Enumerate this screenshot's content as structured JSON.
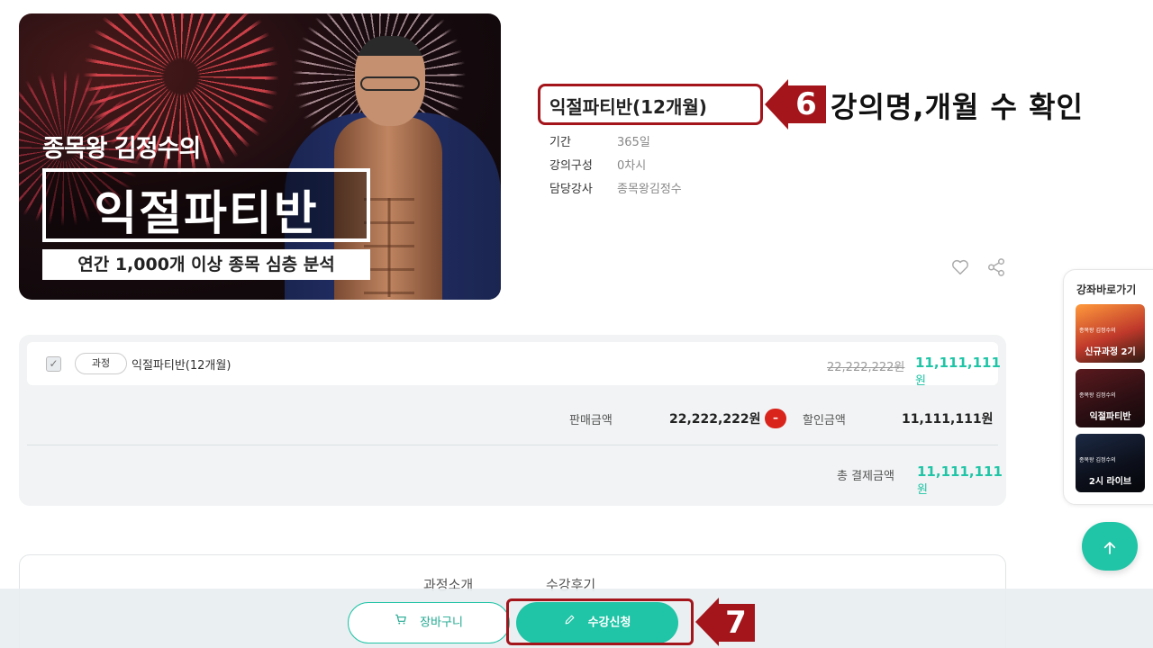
{
  "banner": {
    "subtitle": "종목왕 김정수의",
    "title": "익절파티반",
    "strip": "연간 1,000개 이상 종목 심층 분석"
  },
  "course": {
    "title": "익절파티반(12개월)",
    "info": [
      {
        "label": "기간",
        "value": "365일"
      },
      {
        "label": "강의구성",
        "value": "0차시"
      },
      {
        "label": "담당강사",
        "value": "종목왕김정수"
      }
    ]
  },
  "annotations": {
    "step6_number": "6",
    "step6_text": "강의명,개월 수 확인",
    "step7_number": "7",
    "color": "#a3151b"
  },
  "price": {
    "item_tag": "과정",
    "item_name": "익절파티반(12개월)",
    "item_original": "22,222,222원",
    "item_sale_amount": "11,111,111",
    "currency_unit": "원",
    "sale_label": "판매금액",
    "sale_value": "22,222,222원",
    "minus_symbol": "–",
    "discount_label": "할인금액",
    "discount_value": "11,111,111원",
    "total_label": "총 결제금액",
    "total_amount": "11,111,111"
  },
  "tabs": [
    "과정소개",
    "수강후기"
  ],
  "bottom": {
    "cart_label": "장바구니",
    "apply_label": "수강신청"
  },
  "shortcuts": {
    "title": "강좌바로가기",
    "items": [
      {
        "label": "신규과정 2기",
        "caption": "종목왕 김정수의"
      },
      {
        "label": "익절파티반",
        "caption": "종목왕 김정수의"
      },
      {
        "label": "2시 라이브",
        "caption": "종목왕 김정수의"
      }
    ]
  },
  "colors": {
    "accent": "#20c4a6",
    "annotation": "#a3151b",
    "minus": "#d9241c"
  },
  "icons": [
    "heart-icon",
    "share-icon",
    "cart-icon",
    "pencil-icon",
    "arrow-up-icon",
    "check-icon"
  ]
}
